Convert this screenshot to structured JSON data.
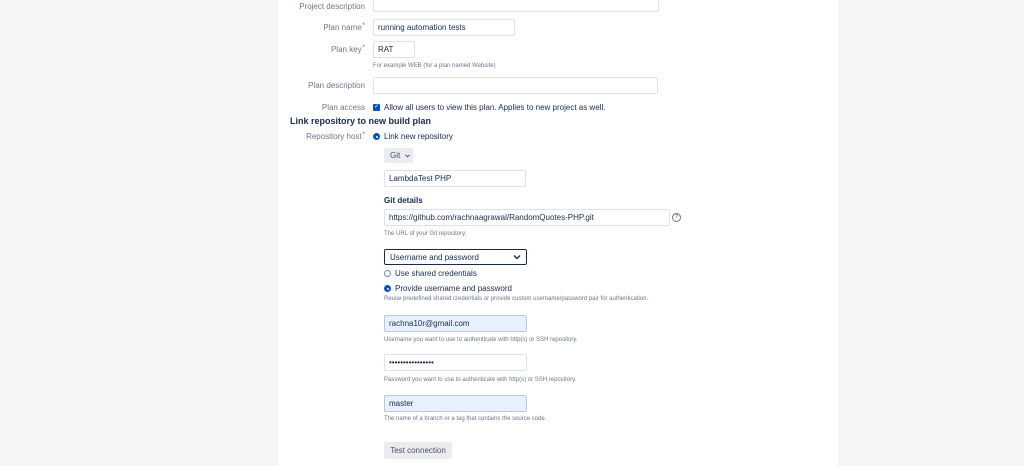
{
  "form": {
    "project_description": {
      "label": "Project description",
      "value": ""
    },
    "plan_name": {
      "label": "Plan name",
      "required_mark": "*",
      "value": "running automation tests"
    },
    "plan_key": {
      "label": "Plan key",
      "required_mark": "*",
      "value": "RAT",
      "hint": "For example WEB (for a plan named Website)"
    },
    "plan_description": {
      "label": "Plan description",
      "value": ""
    },
    "plan_access": {
      "label": "Plan access",
      "checked": true,
      "text": "Allow all users to view this plan. Applies to new project as well."
    }
  },
  "repository": {
    "section_title": "Link repository to new build plan",
    "host_label": "Repository host",
    "required_mark": "*",
    "link_new_label": "Link new repository",
    "type_selected": "Git",
    "display_name": "LambdaTest PHP",
    "git_details_title": "Git details",
    "url": "https://github.com/rachnaagrawal/RandomQuotes-PHP.git",
    "url_hint": "The URL of your Git repository.",
    "auth_selected": "Username and password",
    "use_shared_label": "Use shared credentials",
    "provide_label": "Provide username and password",
    "provide_hint": "Reuse predefined shared credentials or provide custom username/password pair for authentication.",
    "username": "rachna10r@gmail.com",
    "username_hint": "Username you want to use to authenticate with http(s) or SSH repository.",
    "password": "••••••••••••••••",
    "password_hint": "Password you want to use to authenticate with http(s) or SSH repository.",
    "branch": "master",
    "branch_hint": "The name of a branch or a tag that contains the source code.",
    "test_button": "Test connection"
  },
  "colors": {
    "accent": "#0052cc",
    "autofill": "#e8f0fe"
  }
}
